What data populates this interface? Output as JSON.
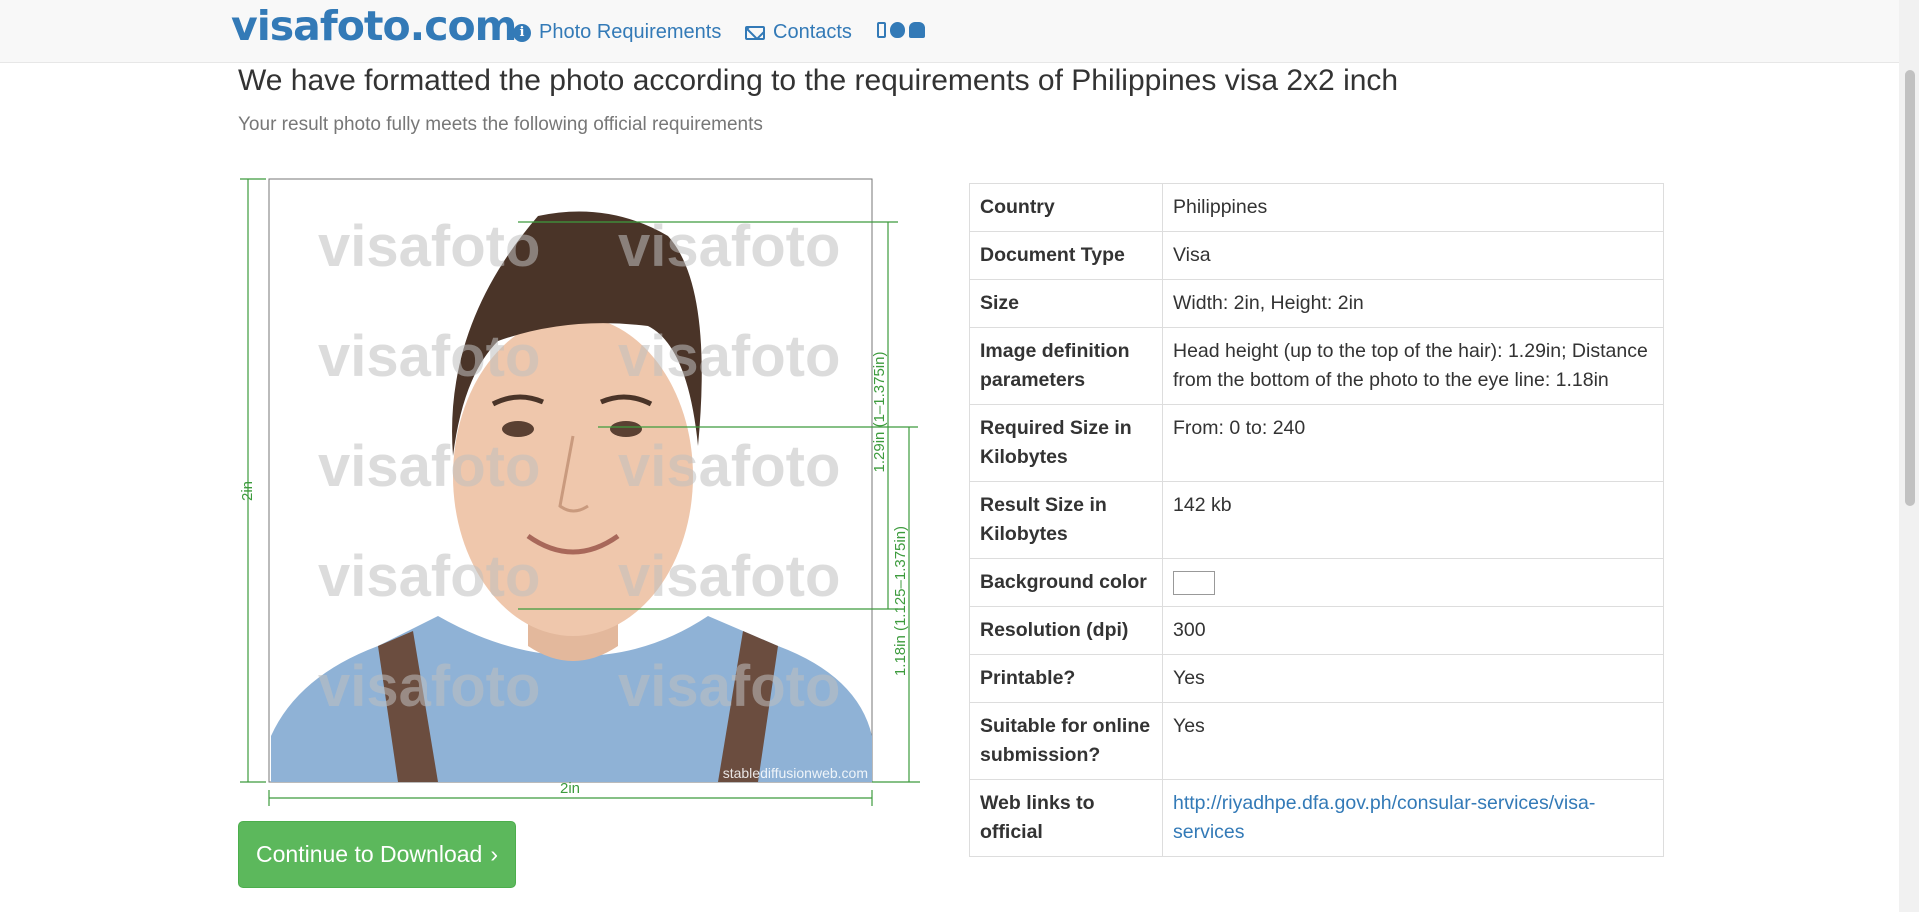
{
  "nav": {
    "logo": "visafoto.com",
    "links": [
      {
        "label": "Photo Requirements",
        "icon": "info-icon"
      },
      {
        "label": "Contacts",
        "icon": "envelope-icon"
      }
    ],
    "app_icons": [
      "mobile-phone-icon",
      "apple-icon",
      "android-icon"
    ]
  },
  "header": {
    "title": "We have formatted the photo according to the requirements of Philippines visa 2x2 inch",
    "subtitle": "Your result photo fully meets the following official requirements"
  },
  "photo": {
    "watermark": "visafoto",
    "credit": "stablediffusionweb.com",
    "dims": {
      "height": "2in",
      "width": "2in",
      "head": "1.29in (1–1.375in)",
      "eye": "1.18in (1.125–1.375in)"
    }
  },
  "button": {
    "label": "Continue to Download",
    "icon": "chevron-right-icon"
  },
  "table": {
    "rows": [
      {
        "key": "Country",
        "value": "Philippines"
      },
      {
        "key": "Document Type",
        "value": "Visa"
      },
      {
        "key": "Size",
        "value": "Width: 2in, Height: 2in"
      },
      {
        "key": "Image definition parameters",
        "value": "Head height (up to the top of the hair): 1.29in; Distance from the bottom of the photo to the eye line: 1.18in"
      },
      {
        "key": "Required Size in Kilobytes",
        "value": "From: 0 to: 240"
      },
      {
        "key": "Result Size in Kilobytes",
        "value": "142 kb"
      },
      {
        "key": "Background color",
        "value": "",
        "swatch": "#ffffff"
      },
      {
        "key": "Resolution (dpi)",
        "value": "300"
      },
      {
        "key": "Printable?",
        "value": "Yes"
      },
      {
        "key": "Suitable for online submission?",
        "value": "Yes"
      },
      {
        "key": "Web links to official",
        "value": "http://riyadhpe.dfa.gov.ph/consular-services/visa-services",
        "link": true
      }
    ]
  },
  "colors": {
    "brand": "#337ab7",
    "button": "#5cb85c",
    "dimension_lines": "#3d9b3d"
  }
}
